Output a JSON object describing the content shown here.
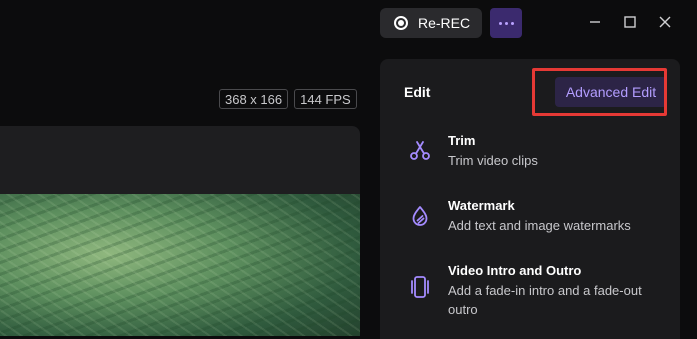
{
  "toolbar": {
    "rerec_label": "Re-REC",
    "rerec_icon": "record-icon",
    "more_icon": "more-dots-icon"
  },
  "window_controls": [
    "minimize-icon",
    "maximize-icon",
    "close-icon"
  ],
  "preview": {
    "resolution": "368 x 166",
    "fps": "144 FPS"
  },
  "edit_panel": {
    "title": "Edit",
    "advanced_label": "Advanced Edit",
    "items": [
      {
        "title": "Trim",
        "desc": "Trim video clips",
        "icon": "scissors-icon"
      },
      {
        "title": "Watermark",
        "desc": "Add text and image watermarks",
        "icon": "watermark-drop-icon"
      },
      {
        "title": "Video Intro and Outro",
        "desc": "Add a fade-in intro and a fade-out outro",
        "icon": "intro-outro-icon"
      }
    ]
  },
  "colors": {
    "accent": "#a48bff",
    "highlight": "#e53935",
    "panel_bg": "#1b1b1d"
  }
}
